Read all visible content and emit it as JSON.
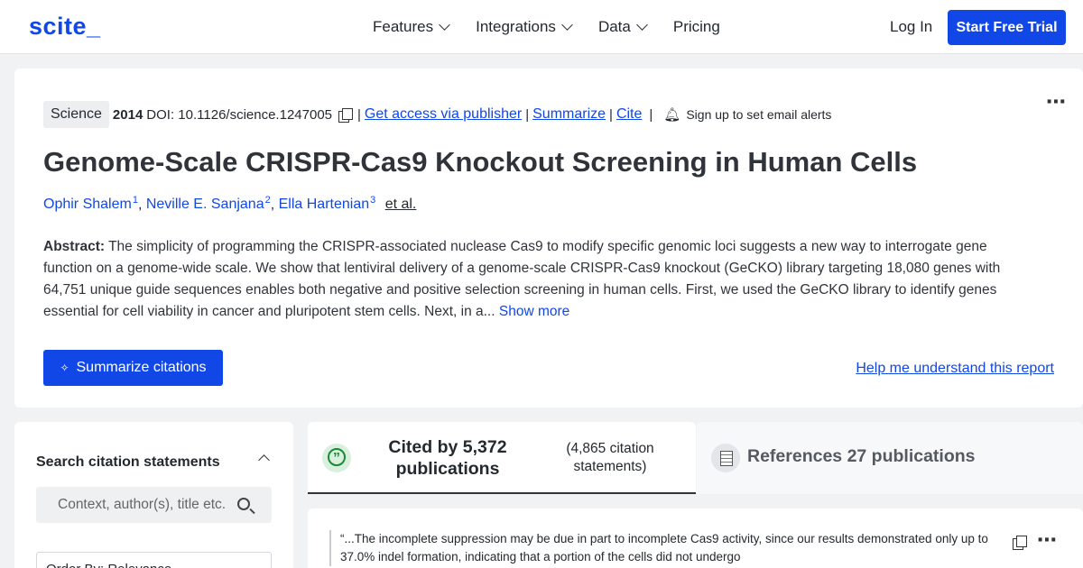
{
  "nav": {
    "logo": "scite_",
    "menu": [
      "Features",
      "Integrations",
      "Data",
      "Pricing"
    ],
    "login": "Log In",
    "trial": "Start Free Trial"
  },
  "paper": {
    "journal": "Science",
    "year": "2014",
    "doi": "DOI: 10.1126/science.1247005",
    "links": {
      "access": "Get access via publisher",
      "summarize": "Summarize",
      "cite": "Cite"
    },
    "alerts": "Sign up to set email alerts",
    "title": "Genome-Scale CRISPR-Cas9 Knockout Screening in Human Cells",
    "authors": [
      {
        "name": "Ophir Shalem",
        "sup": "1"
      },
      {
        "name": "Neville E. Sanjana",
        "sup": "2"
      },
      {
        "name": "Ella Hartenian",
        "sup": "3"
      }
    ],
    "etal": "et al.",
    "abstract_label": "Abstract:",
    "abstract": "The simplicity of programming the CRISPR-associated nuclease Cas9 to modify specific genomic loci suggests a new way to interrogate gene function on a genome-wide scale. We show that lentiviral delivery of a genome-scale CRISPR-Cas9 knockout (GeCKO) library targeting 18,080 genes with 64,751 unique guide sequences enables both negative and positive selection screening in human cells. First, we used the GeCKO library to identify genes essential for cell viability in cancer and pluripotent stem cells. Next, in a...",
    "show_more": "Show more",
    "summarize_citations": "Summarize citations",
    "help": "Help me understand this report"
  },
  "search_panel": {
    "title": "Search citation statements",
    "placeholder": "Context, author(s), title etc.",
    "order_by": "Order By: Relevance"
  },
  "tabs": {
    "cited_by": "Cited by 5,372 publications",
    "statements": "(4,865 citation statements)",
    "references": "References 27 publications"
  },
  "citation": {
    "quote": "“...The incomplete suppression may be due in part to incomplete Cas9 activity, since our results demonstrated only up to 37.0% indel formation, indicating that a portion of the cells did not undergo"
  }
}
